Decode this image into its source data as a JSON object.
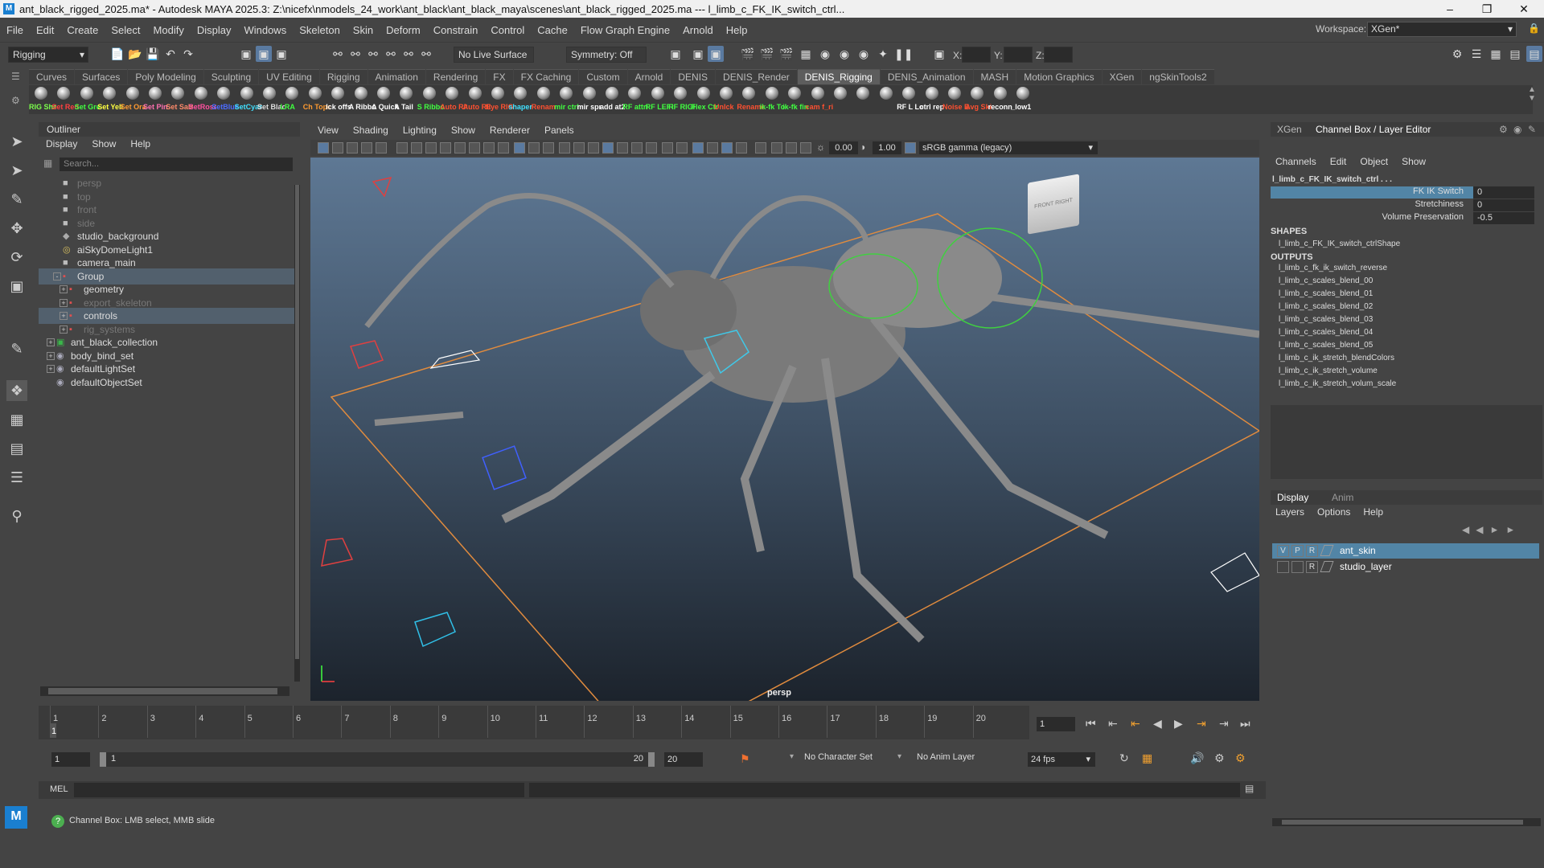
{
  "titlebar": {
    "text": "ant_black_rigged_2025.ma* - Autodesk MAYA 2025.3: Z:\\nicefx\\nmodels_24_work\\ant_black\\ant_black_maya\\scenes\\ant_black_rigged_2025.ma    ---   l_limb_c_FK_IK_switch_ctrl..."
  },
  "menubar": [
    "File",
    "Edit",
    "Create",
    "Select",
    "Modify",
    "Display",
    "Windows",
    "Skeleton",
    "Skin",
    "Deform",
    "Constrain",
    "Control",
    "Cache",
    "Flow Graph Engine",
    "Arnold",
    "Help"
  ],
  "workspace": {
    "label": "Workspace:",
    "value": "XGen*"
  },
  "toolbar": {
    "mode": "Rigging",
    "live_surface": "No Live Surface",
    "symmetry": "Symmetry: Off",
    "x": "X:",
    "y": "Y:",
    "z": "Z:"
  },
  "shelf_tabs": [
    "Curves",
    "Surfaces",
    "Poly Modeling",
    "Sculpting",
    "UV Editing",
    "Rigging",
    "Animation",
    "Rendering",
    "FX",
    "FX Caching",
    "Custom",
    "Arnold",
    "DENIS",
    "DENIS_Render",
    "DENIS_Rigging",
    "DENIS_Animation",
    "MASH",
    "Motion Graphics",
    "XGen",
    "ngSkinTools2"
  ],
  "shelf_active": "DENIS_Rigging",
  "shelf_items": [
    {
      "label": "RIG Sha",
      "color": "#7cff4c"
    },
    {
      "label": "Set Red",
      "color": "#ff4040"
    },
    {
      "label": "Set Gre",
      "color": "#40ff40"
    },
    {
      "label": "Set Yell",
      "color": "#ffff40"
    },
    {
      "label": "Set Ora",
      "color": "#ff9a30"
    },
    {
      "label": "Set Pin",
      "color": "#ff70b0"
    },
    {
      "label": "Set Sala",
      "color": "#ff8a6a"
    },
    {
      "label": "SetRose",
      "color": "#ff50a0"
    },
    {
      "label": "SetBlue",
      "color": "#4c6cff"
    },
    {
      "label": "SetCyan",
      "color": "#40e0ff"
    },
    {
      "label": "Set Blac",
      "color": "#dddddd"
    },
    {
      "label": "LRA",
      "color": "#40ff40"
    },
    {
      "label": "Ch Topo",
      "color": "#ff9a30"
    },
    {
      "label": "lck offs",
      "color": "#ffffff"
    },
    {
      "label": "A Ribbo",
      "color": "#ffffff"
    },
    {
      "label": "A Quick",
      "color": "#ffffff"
    },
    {
      "label": "A Tail",
      "color": "#ffffff"
    },
    {
      "label": "S Ribbo",
      "color": "#40ff40"
    },
    {
      "label": "Auto RIG",
      "color": "#ff5030"
    },
    {
      "label": "Auto RIG",
      "color": "#ff5030"
    },
    {
      "label": "Eye RIG",
      "color": "#ff5030"
    },
    {
      "label": "shaper",
      "color": "#40e0ff"
    },
    {
      "label": "Renam",
      "color": "#ff5030"
    },
    {
      "label": "mir ctrl",
      "color": "#40ff40"
    },
    {
      "label": "mir spr",
      "color": "#ffffff"
    },
    {
      "label": "add at2",
      "color": "#ffffff"
    },
    {
      "label": "RF attri",
      "color": "#40ff40"
    },
    {
      "label": "RF LEFT",
      "color": "#40ff40"
    },
    {
      "label": "RF RIGH",
      "color": "#40ff40"
    },
    {
      "label": "Flex Ctr",
      "color": "#40ff40"
    },
    {
      "label": "Unlck",
      "color": "#ff5030"
    },
    {
      "label": "Rename",
      "color": "#ff5030"
    },
    {
      "label": "ik-fk To",
      "color": "#40ff40"
    },
    {
      "label": "ik-fk fin",
      "color": "#40ff40"
    },
    {
      "label": "cam f_ri",
      "color": "#ff5030"
    },
    {
      "label": "",
      "color": "#ffffff"
    },
    {
      "label": "",
      "color": "#ffffff"
    },
    {
      "label": "",
      "color": "#ffffff"
    },
    {
      "label": "RF L Lo",
      "color": "#ffffff"
    },
    {
      "label": "ctrl rep",
      "color": "#ffffff"
    },
    {
      "label": "Noise E",
      "color": "#ff5030"
    },
    {
      "label": "Avg Ski",
      "color": "#ff5030"
    },
    {
      "label": "reconn",
      "color": "#ffffff"
    },
    {
      "label": "_low1",
      "color": "#ffffff"
    }
  ],
  "outliner": {
    "title": "Outliner",
    "menu": [
      "Display",
      "Show",
      "Help"
    ],
    "search_placeholder": "Search...",
    "items": [
      {
        "label": "persp",
        "dim": true,
        "indent": 0,
        "icon": "camera",
        "exp": ""
      },
      {
        "label": "top",
        "dim": true,
        "indent": 0,
        "icon": "camera",
        "exp": ""
      },
      {
        "label": "front",
        "dim": true,
        "indent": 0,
        "icon": "camera",
        "exp": ""
      },
      {
        "label": "side",
        "dim": true,
        "indent": 0,
        "icon": "camera",
        "exp": ""
      },
      {
        "label": "studio_background",
        "dim": false,
        "indent": 0,
        "icon": "mesh",
        "exp": ""
      },
      {
        "label": "aiSkyDomeLight1",
        "dim": false,
        "indent": 0,
        "icon": "sky",
        "exp": ""
      },
      {
        "label": "camera_main",
        "dim": false,
        "indent": 0,
        "icon": "camera",
        "exp": ""
      },
      {
        "label": "Group",
        "dim": false,
        "indent": 0,
        "icon": "group",
        "exp": "-",
        "sel": true
      },
      {
        "label": "geometry",
        "dim": false,
        "indent": 1,
        "icon": "group",
        "exp": "+"
      },
      {
        "label": "export_skeleton",
        "dim": true,
        "indent": 1,
        "icon": "group",
        "exp": "+"
      },
      {
        "label": "controls",
        "dim": false,
        "indent": 1,
        "icon": "group",
        "exp": "+",
        "sel": true
      },
      {
        "label": "rig_systems",
        "dim": true,
        "indent": 1,
        "icon": "group",
        "exp": "+"
      },
      {
        "label": "ant_black_collection",
        "dim": false,
        "indent": -1,
        "icon": "collection",
        "exp": "+"
      },
      {
        "label": "body_bind_set",
        "dim": false,
        "indent": -1,
        "icon": "set",
        "exp": "+"
      },
      {
        "label": "defaultLightSet",
        "dim": false,
        "indent": -1,
        "icon": "set",
        "exp": "+"
      },
      {
        "label": "defaultObjectSet",
        "dim": false,
        "indent": -1,
        "icon": "set",
        "exp": ""
      }
    ]
  },
  "viewport": {
    "menu": [
      "View",
      "Shading",
      "Lighting",
      "Show",
      "Renderer",
      "Panels"
    ],
    "exposure": "0.00",
    "gamma": "1.00",
    "colorspace": "sRGB gamma (legacy)",
    "camera_label": "persp",
    "cube_front": "FRONT",
    "cube_right": "RIGHT"
  },
  "channelbox": {
    "tabs": [
      "XGen",
      "Channel Box / Layer Editor"
    ],
    "menu": [
      "Channels",
      "Edit",
      "Object",
      "Show"
    ],
    "node": "l_limb_c_FK_IK_switch_ctrl . . .",
    "channels": [
      {
        "name": "FK IK Switch",
        "value": "0",
        "sel": true
      },
      {
        "name": "Stretchiness",
        "value": "0"
      },
      {
        "name": "Volume Preservation",
        "value": "-0.5"
      }
    ],
    "shapes_header": "SHAPES",
    "shape": "l_limb_c_FK_IK_switch_ctrlShape",
    "outputs_header": "OUTPUTS",
    "outputs": [
      "l_limb_c_fk_ik_switch_reverse",
      "l_limb_c_scales_blend_00",
      "l_limb_c_scales_blend_01",
      "l_limb_c_scales_blend_02",
      "l_limb_c_scales_blend_03",
      "l_limb_c_scales_blend_04",
      "l_limb_c_scales_blend_05",
      "l_limb_c_ik_stretch_blendColors",
      "l_limb_c_ik_stretch_volume",
      "l_limb_c_ik_stretch_volum_scale"
    ]
  },
  "layers": {
    "tabs": [
      "Display",
      "Anim"
    ],
    "menu": [
      "Layers",
      "Options",
      "Help"
    ],
    "rows": [
      {
        "v": "V",
        "p": "P",
        "r": "R",
        "name": "ant_skin",
        "sel": true
      },
      {
        "v": "",
        "p": "",
        "r": "R",
        "name": "studio_layer",
        "sel": false
      }
    ]
  },
  "timeline": {
    "ticks": [
      "1",
      "2",
      "3",
      "4",
      "5",
      "6",
      "7",
      "8",
      "9",
      "10",
      "11",
      "12",
      "13",
      "14",
      "15",
      "16",
      "17",
      "18",
      "19",
      "20"
    ],
    "current": "1",
    "current_field": "1"
  },
  "range": {
    "start": "1",
    "slider_start": "1",
    "slider_end": "20",
    "end": "20",
    "character_set": "No Character Set",
    "anim_layer": "No Anim Layer",
    "fps": "24 fps"
  },
  "mel": {
    "label": "MEL"
  },
  "status": {
    "text": "Channel Box: LMB select, MMB slide"
  }
}
